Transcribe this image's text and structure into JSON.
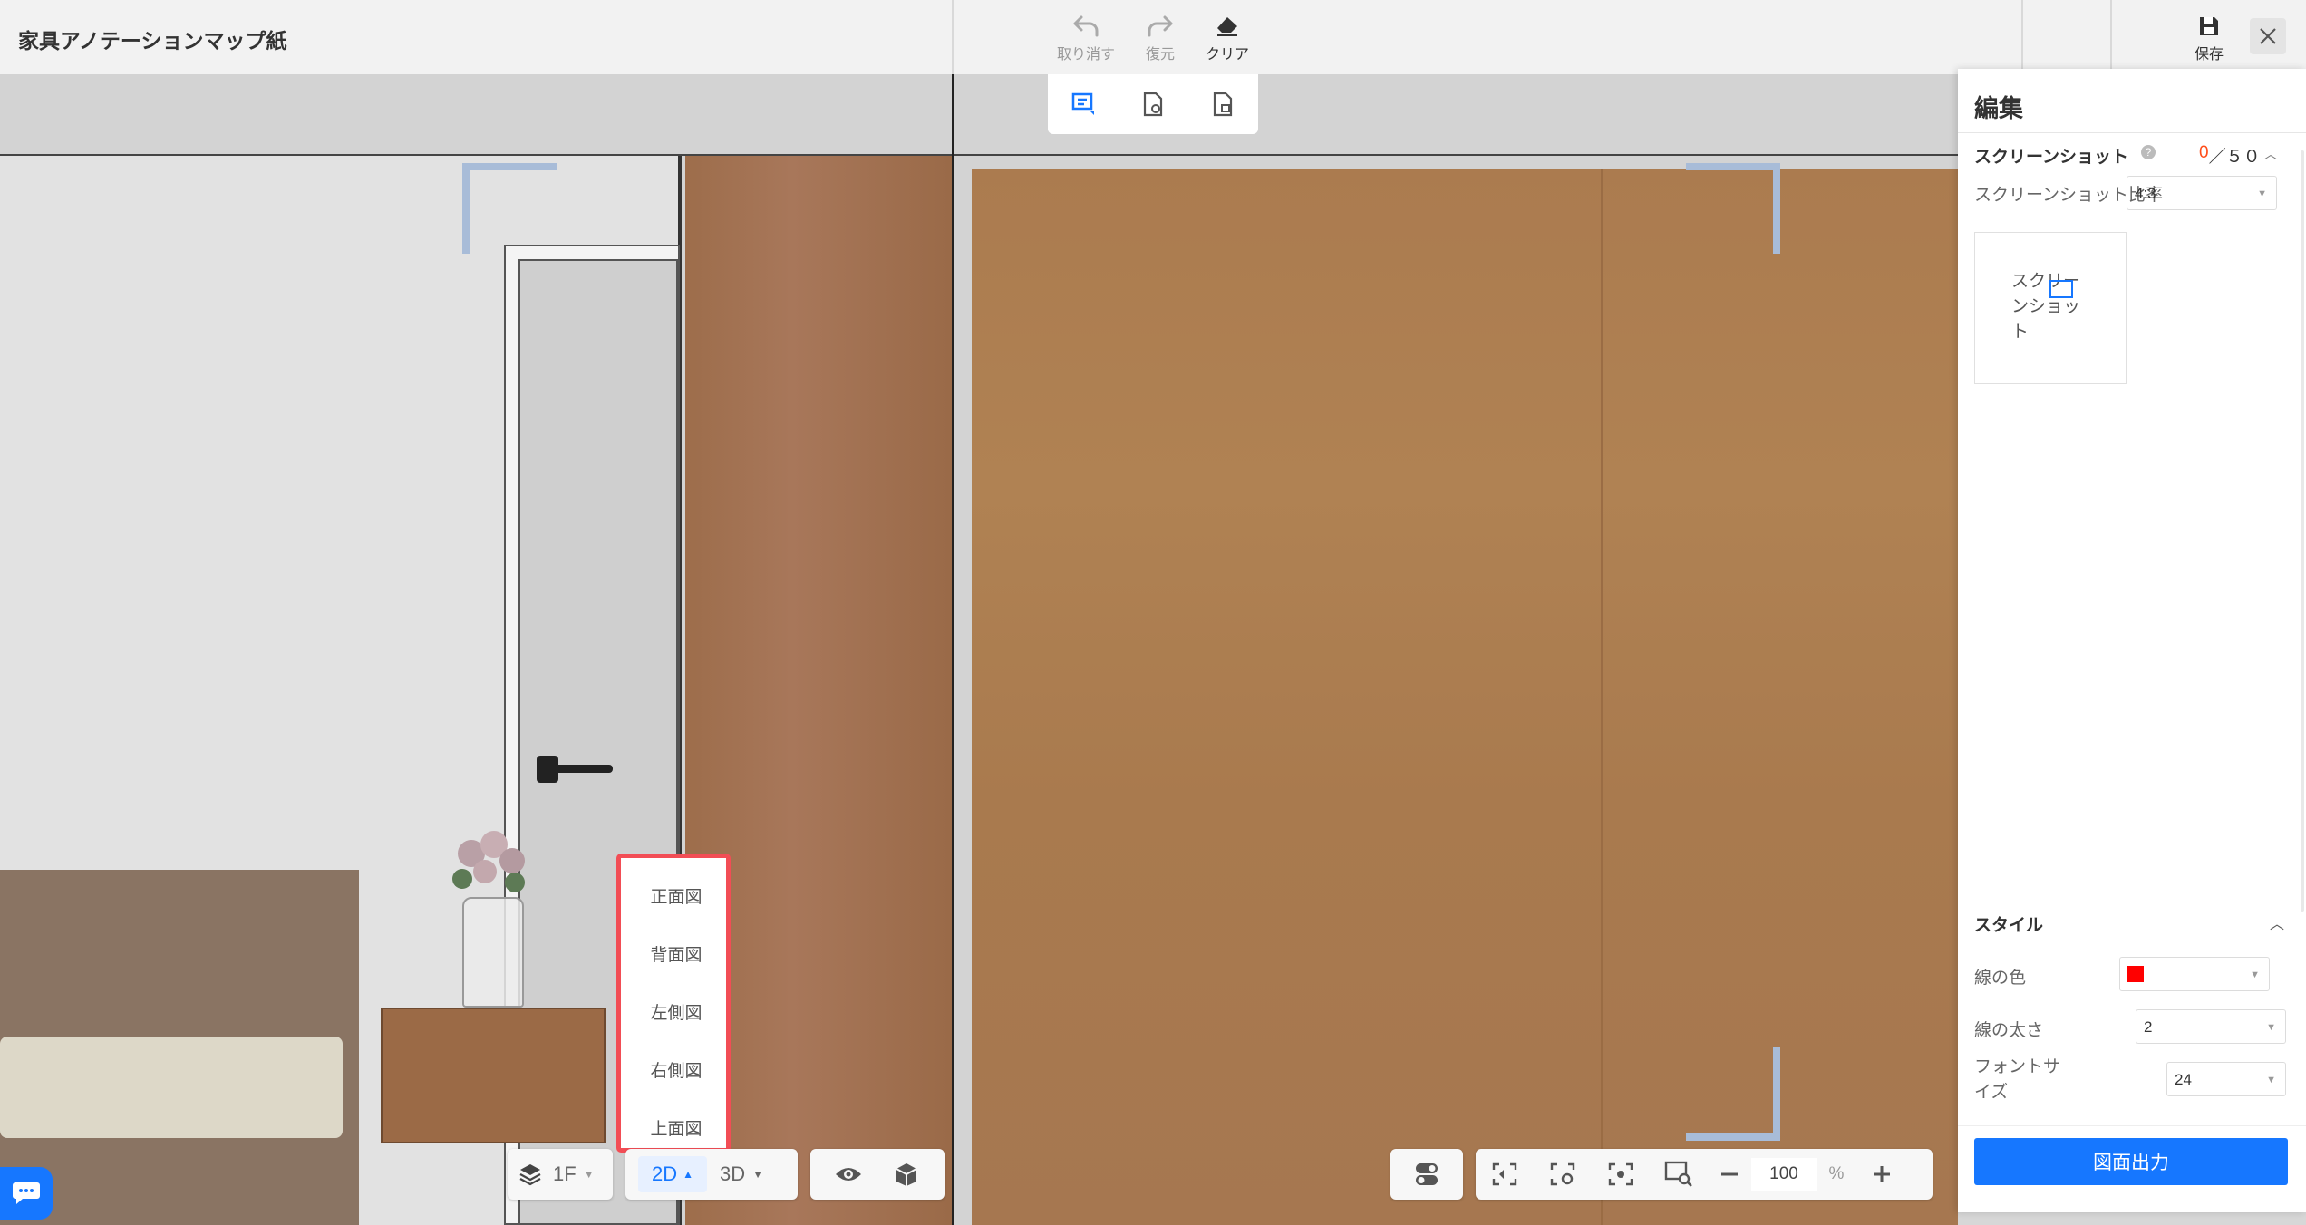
{
  "app": {
    "title": "家具アノテーションマップ紙"
  },
  "toolbar": {
    "undo": "取り消す",
    "redo": "復元",
    "clear": "クリア",
    "save": "保存"
  },
  "panel": {
    "title": "編集",
    "screenshot_section": "スクリーンショット",
    "screenshot_count": "0",
    "screenshot_sep": "／",
    "screenshot_max": "５０",
    "ratio_label": "スクリーンショット比率",
    "ratio_value": "4:3",
    "thumb_label": "スクリーンショット",
    "style_section": "スタイル",
    "line_color_label": "線の色",
    "line_color": "#ff0000",
    "line_width_label": "線の太さ",
    "line_width_value": "2",
    "font_size_label": "フォントサイズ",
    "font_size_value": "24",
    "export_button": "図面出力"
  },
  "view_menu": {
    "items": [
      "正面図",
      "背面図",
      "左側図",
      "右側図",
      "上面図"
    ]
  },
  "bottom_bar": {
    "floor": "1F",
    "mode_2d": "2D",
    "mode_3d": "3D",
    "zoom": "100",
    "zoom_unit": "%"
  },
  "colors": {
    "accent": "#1677ff",
    "highlight_border": "#f24d55",
    "wood": "#a5774e"
  }
}
